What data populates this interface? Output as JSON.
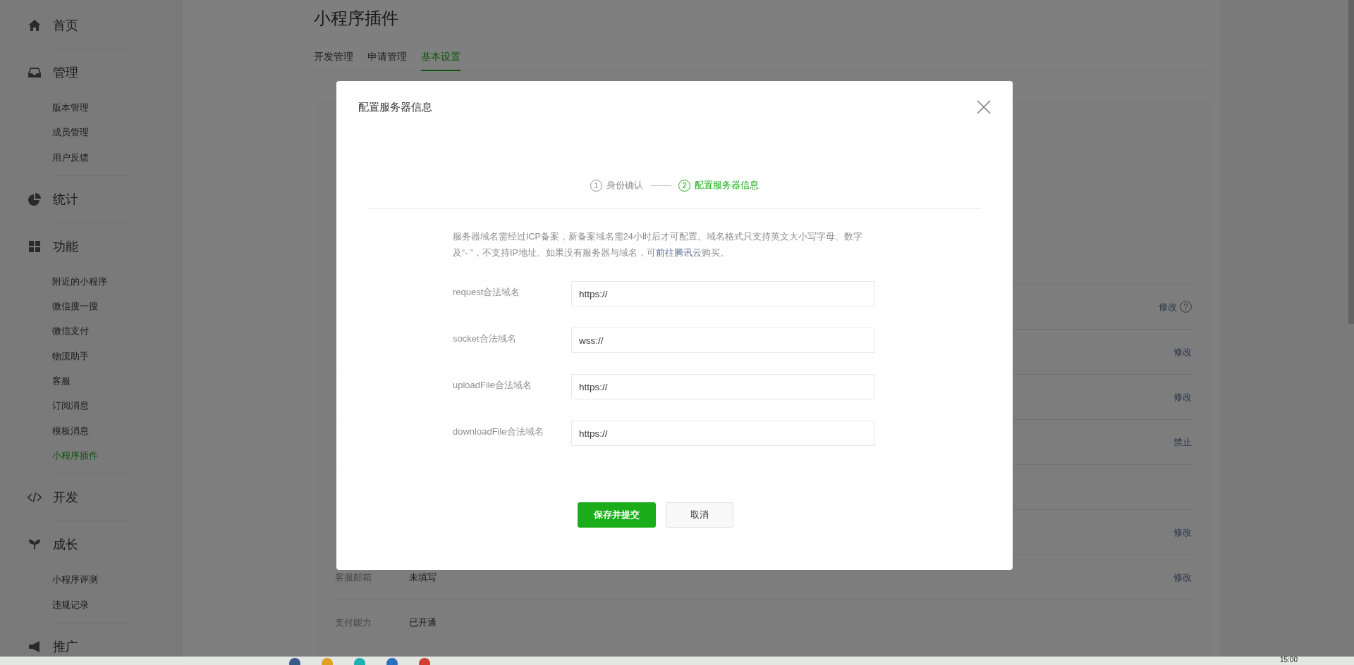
{
  "sidebar": {
    "groups": [
      {
        "label": "首页"
      },
      {
        "label": "管理",
        "children": [
          {
            "label": "版本管理",
            "selected": false
          },
          {
            "label": "成员管理",
            "selected": false
          },
          {
            "label": "用户反馈",
            "selected": false
          }
        ]
      },
      {
        "label": "统计"
      },
      {
        "label": "功能",
        "children": [
          {
            "label": "附近的小程序",
            "selected": false
          },
          {
            "label": "微信搜一搜",
            "selected": false
          },
          {
            "label": "微信支付",
            "selected": false
          },
          {
            "label": "物流助手",
            "selected": false
          },
          {
            "label": "客服",
            "selected": false
          },
          {
            "label": "订阅消息",
            "selected": false
          },
          {
            "label": "模板消息",
            "selected": false
          },
          {
            "label": "小程序插件",
            "selected": true
          }
        ]
      },
      {
        "label": "开发"
      },
      {
        "label": "成长",
        "children": [
          {
            "label": "小程序评测",
            "selected": false
          },
          {
            "label": "违规记录",
            "selected": false
          }
        ]
      },
      {
        "label": "推广"
      }
    ]
  },
  "page": {
    "title": "小程序插件",
    "tabs": [
      {
        "label": "开发管理",
        "selected": false
      },
      {
        "label": "申请管理",
        "selected": false
      },
      {
        "label": "基本设置",
        "selected": true
      }
    ],
    "settings_rows": [
      {
        "action": "修改",
        "help": true
      },
      {
        "action": "修改",
        "help": false
      },
      {
        "action": "修改",
        "help": false
      },
      {
        "action": "禁止",
        "help": false
      },
      {
        "help": false
      },
      {
        "action": "修改",
        "help": false
      },
      {
        "label": "客服邮箱",
        "value": "未填写",
        "action": "修改",
        "help": false
      },
      {
        "label": "支付能力",
        "value": "已开通",
        "help": false
      }
    ]
  },
  "dialog": {
    "title": "配置服务器信息",
    "steps": [
      {
        "number": "1",
        "label": "身份确认",
        "selected": false
      },
      {
        "number": "2",
        "label": "配置服务器信息",
        "selected": true
      }
    ],
    "notice": {
      "text": "服务器域名需经过ICP备案，新备案域名需24小时后才可配置。域名格式只支持英文大小写字母、数字及“- ”，不支持IP地址。如果没有服务器与域名，可",
      "link": "前往腾讯云",
      "after": "购买。"
    },
    "fields": [
      {
        "label": "request合法域名",
        "value": "https://"
      },
      {
        "label": "socket合法域名",
        "value": "wss://"
      },
      {
        "label": "uploadFile合法域名",
        "value": "https://"
      },
      {
        "label": "downloadFile合法域名",
        "value": "https://"
      }
    ],
    "buttons": [
      {
        "label": "保存并提交",
        "kind": "primary"
      },
      {
        "label": "取消",
        "kind": "default"
      }
    ]
  },
  "taskbar": {
    "time": "15:00"
  }
}
